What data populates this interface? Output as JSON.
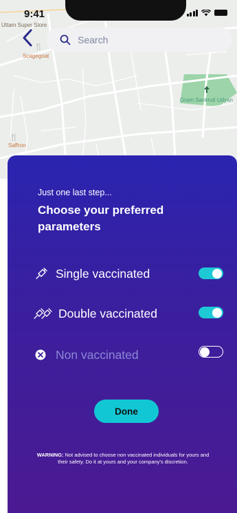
{
  "status_bar": {
    "time": "9:41"
  },
  "map": {
    "labels": {
      "top_left": "Uttam Super Store",
      "place_1": "Scagegoat",
      "place_2": "Gram Sankruti Udyan",
      "place_3": "Saffron"
    }
  },
  "search": {
    "placeholder": "Search"
  },
  "sheet": {
    "intro": "Just one last step...",
    "title": "Choose your preferred parameters",
    "options": [
      {
        "icon": "syringe-icon",
        "label": "Single vaccinated",
        "enabled": true
      },
      {
        "icon": "double-syringe-icon",
        "label": "Double vaccinated",
        "enabled": true
      },
      {
        "icon": "close-circle-icon",
        "label": "Non vaccinated",
        "enabled": false
      }
    ],
    "done_label": "Done",
    "warning_prefix": "WARNING:",
    "warning_text": " Not advised to choose non vaccinated individuals for yours and their safety. Do it at yours and your company's discretion."
  },
  "colors": {
    "accent": "#1ec9d6",
    "sheet_top": "#2a24b0",
    "sheet_bottom": "#4b1a92"
  }
}
